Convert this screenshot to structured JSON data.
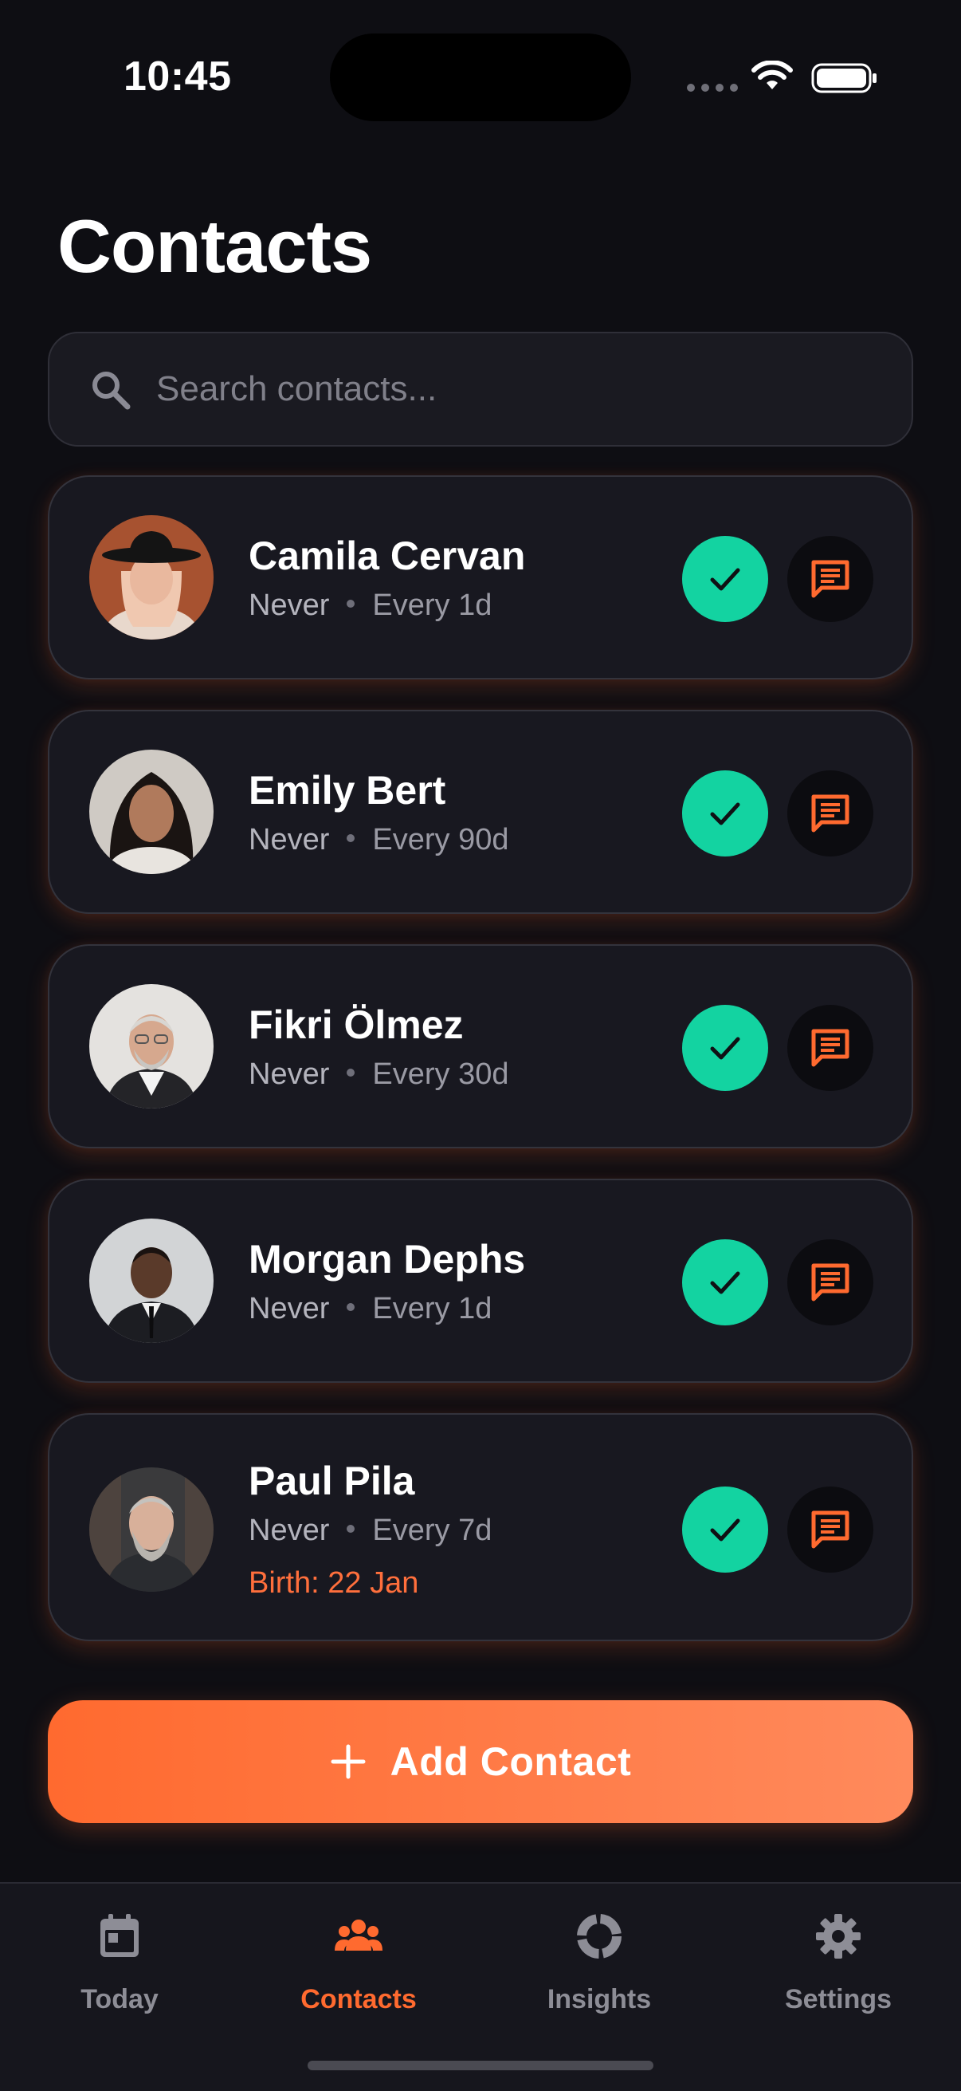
{
  "status_bar": {
    "time": "10:45"
  },
  "page": {
    "title": "Contacts"
  },
  "search": {
    "placeholder": "Search contacts..."
  },
  "contacts": [
    {
      "name": "Camila Cervan",
      "last_contact": "Never",
      "frequency": "Every 1d",
      "birthday": ""
    },
    {
      "name": "Emily Bert",
      "last_contact": "Never",
      "frequency": "Every 90d",
      "birthday": ""
    },
    {
      "name": "Fikri Ölmez",
      "last_contact": "Never",
      "frequency": "Every 30d",
      "birthday": ""
    },
    {
      "name": "Morgan Dephs",
      "last_contact": "Never",
      "frequency": "Every 1d",
      "birthday": ""
    },
    {
      "name": "Paul Pila",
      "last_contact": "Never",
      "frequency": "Every 7d",
      "birthday": "Birth: 22 Jan"
    }
  ],
  "add_button": {
    "label": "Add Contact",
    "icon": "plus-icon"
  },
  "tabs": [
    {
      "label": "Today",
      "icon": "calendar-icon",
      "active": false
    },
    {
      "label": "Contacts",
      "icon": "people-icon",
      "active": true
    },
    {
      "label": "Insights",
      "icon": "donut-chart-icon",
      "active": false
    },
    {
      "label": "Settings",
      "icon": "gear-icon",
      "active": false
    }
  ],
  "colors": {
    "accent": "#ff6a2f",
    "check": "#13d3a1",
    "background": "#0e0e13",
    "card": "#181820"
  }
}
